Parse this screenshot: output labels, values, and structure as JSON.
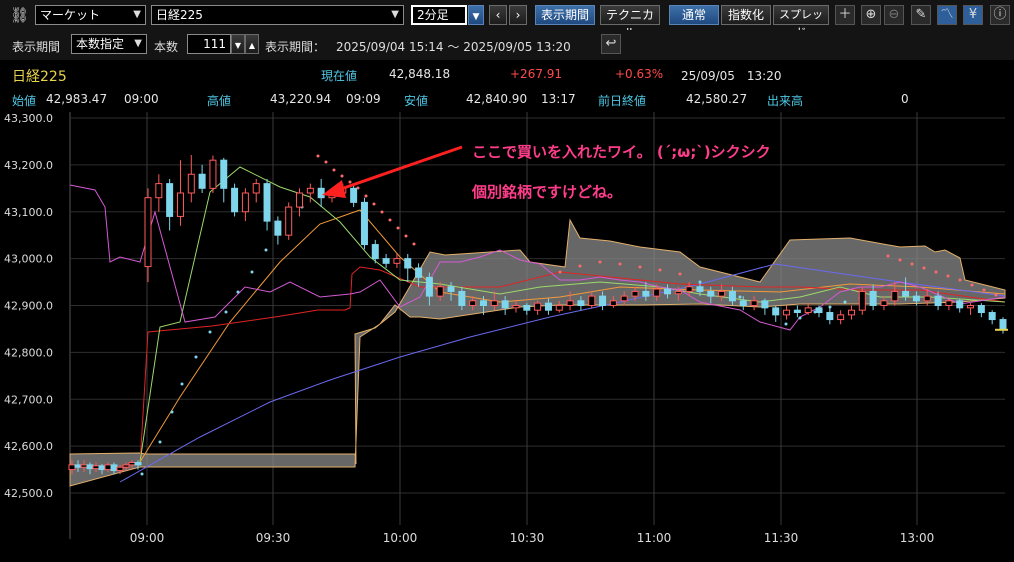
{
  "toolbar": {
    "market_select": "マーケット",
    "symbol_select": "日経225",
    "interval_select": "2分足",
    "period_button": "表示期間",
    "technical_button": "テクニカル",
    "normal_button": "通常",
    "index_button": "指数化",
    "spread_button": "スプレッド",
    "yen_icon": "¥"
  },
  "settings": {
    "period_label": "表示期間",
    "period_select": "本数指定",
    "count_label": "本数",
    "count_value": "111",
    "range_label": "表示期間：",
    "range_value": "2025/09/04 15:14 ～ 2025/09/05 13:20"
  },
  "quote": {
    "name": "日経225",
    "current_label": "現在値",
    "current_value": "42,848.18",
    "change": "+267.91",
    "change_pct": "+0.63%",
    "datetime": "25/09/05　13:20",
    "open_label": "始値",
    "open_value": "42,983.47",
    "open_time": "09:00",
    "high_label": "高値",
    "high_value": "43,220.94",
    "high_time": "09:09",
    "low_label": "安値",
    "low_value": "42,840.90",
    "low_time": "13:17",
    "prev_label": "前日終値",
    "prev_value": "42,580.27",
    "volume_label": "出来高",
    "volume_value": "0"
  },
  "annotation": {
    "line1": "ここで買いを入れたワイ。 (´;ω;`)シクシク",
    "line2": "個別銘柄ですけどね。"
  },
  "colors": {
    "up_candle": "#ff5a5a",
    "down_candle": "#7fd6ec",
    "cloud": "#8a8a8a",
    "annotation": "#ff3d8b"
  },
  "chart_data": {
    "type": "candlestick",
    "y_ticks": [
      "43,300.0",
      "43,200.0",
      "43,100.0",
      "43,000.0",
      "42,900.0",
      "42,800.0",
      "42,700.0",
      "42,600.0",
      "42,500.0"
    ],
    "x_ticks": [
      "09:00",
      "09:30",
      "10:00",
      "10:30",
      "11:00",
      "11:30",
      "13:00"
    ],
    "ylim": [
      42480,
      43300
    ],
    "candles": [
      [
        42550,
        42560,
        42540,
        42570
      ],
      [
        42560,
        42555,
        42545,
        42570
      ],
      [
        42555,
        42560,
        42545,
        42570
      ],
      [
        42560,
        42552,
        42540,
        42565
      ],
      [
        42552,
        42558,
        42545,
        42565
      ],
      [
        42558,
        42550,
        42540,
        42562
      ],
      [
        42550,
        42560,
        42545,
        42565
      ],
      [
        42560,
        42548,
        42540,
        42565
      ],
      [
        42548,
        42555,
        42540,
        42560
      ],
      [
        42555,
        42560,
        42548,
        42565
      ],
      [
        42560,
        42565,
        42552,
        42570
      ],
      [
        42565,
        42560,
        42550,
        42570
      ],
      [
        42983,
        43130,
        42950,
        43150
      ],
      [
        43130,
        43160,
        43100,
        43180
      ],
      [
        43160,
        43090,
        43060,
        43170
      ],
      [
        43090,
        43140,
        43070,
        43210
      ],
      [
        43140,
        43180,
        43120,
        43221
      ],
      [
        43180,
        43150,
        43140,
        43200
      ],
      [
        43150,
        43210,
        43140,
        43220
      ],
      [
        43210,
        43150,
        43120,
        43215
      ],
      [
        43150,
        43100,
        43090,
        43160
      ],
      [
        43100,
        43140,
        43080,
        43150
      ],
      [
        43140,
        43160,
        43120,
        43170
      ],
      [
        43160,
        43080,
        43060,
        43170
      ],
      [
        43080,
        43050,
        43030,
        43090
      ],
      [
        43050,
        43110,
        43040,
        43120
      ],
      [
        43110,
        43140,
        43090,
        43150
      ],
      [
        43140,
        43150,
        43120,
        43160
      ],
      [
        43150,
        43130,
        43110,
        43170
      ],
      [
        43130,
        43140,
        43120,
        43150
      ],
      [
        43140,
        43150,
        43130,
        43160
      ],
      [
        43150,
        43120,
        43110,
        43160
      ],
      [
        43120,
        43030,
        43020,
        43130
      ],
      [
        43030,
        43000,
        42990,
        43040
      ],
      [
        43000,
        42990,
        42980,
        43010
      ],
      [
        42990,
        43000,
        42980,
        43010
      ],
      [
        43000,
        42980,
        42950,
        43010
      ],
      [
        42980,
        42960,
        42940,
        42990
      ],
      [
        42960,
        42920,
        42900,
        42970
      ],
      [
        42920,
        42940,
        42910,
        42950
      ],
      [
        42940,
        42930,
        42910,
        42950
      ],
      [
        42930,
        42900,
        42890,
        42940
      ],
      [
        42900,
        42910,
        42890,
        42920
      ],
      [
        42910,
        42900,
        42880,
        42920
      ],
      [
        42900,
        42910,
        42890,
        42930
      ],
      [
        42910,
        42895,
        42880,
        42920
      ],
      [
        42895,
        42900,
        42885,
        42910
      ],
      [
        42900,
        42890,
        42880,
        42905
      ],
      [
        42890,
        42905,
        42880,
        42910
      ],
      [
        42905,
        42890,
        42880,
        42915
      ],
      [
        42890,
        42900,
        42885,
        42910
      ],
      [
        42900,
        42910,
        42890,
        42930
      ],
      [
        42910,
        42900,
        42890,
        42920
      ],
      [
        42900,
        42920,
        42895,
        42930
      ],
      [
        42920,
        42900,
        42890,
        42930
      ],
      [
        42900,
        42910,
        42895,
        42920
      ],
      [
        42910,
        42920,
        42900,
        42930
      ],
      [
        42920,
        42930,
        42910,
        42940
      ],
      [
        42930,
        42920,
        42910,
        42950
      ],
      [
        42920,
        42935,
        42910,
        42945
      ],
      [
        42935,
        42925,
        42915,
        42945
      ],
      [
        42925,
        42930,
        42910,
        42940
      ],
      [
        42930,
        42940,
        42920,
        42950
      ],
      [
        42940,
        42930,
        42920,
        42950
      ],
      [
        42930,
        42920,
        42905,
        42940
      ],
      [
        42920,
        42930,
        42910,
        42945
      ],
      [
        42930,
        42910,
        42900,
        42940
      ],
      [
        42910,
        42900,
        42890,
        42920
      ],
      [
        42900,
        42910,
        42890,
        42920
      ],
      [
        42910,
        42895,
        42880,
        42915
      ],
      [
        42895,
        42880,
        42865,
        42900
      ],
      [
        42880,
        42890,
        42870,
        42900
      ],
      [
        42890,
        42885,
        42875,
        42900
      ],
      [
        42885,
        42895,
        42880,
        42905
      ],
      [
        42895,
        42885,
        42875,
        42900
      ],
      [
        42885,
        42870,
        42860,
        42895
      ],
      [
        42870,
        42880,
        42860,
        42890
      ],
      [
        42880,
        42890,
        42870,
        42900
      ],
      [
        42890,
        42930,
        42880,
        42940
      ],
      [
        42930,
        42900,
        42890,
        42945
      ],
      [
        42900,
        42910,
        42890,
        42920
      ],
      [
        42910,
        42930,
        42900,
        42950
      ],
      [
        42930,
        42920,
        42910,
        42960
      ],
      [
        42920,
        42910,
        42900,
        42930
      ],
      [
        42910,
        42920,
        42900,
        42935
      ],
      [
        42920,
        42900,
        42890,
        42930
      ],
      [
        42900,
        42910,
        42890,
        42915
      ],
      [
        42910,
        42895,
        42885,
        42915
      ],
      [
        42895,
        42900,
        42880,
        42905
      ],
      [
        42900,
        42885,
        42875,
        42905
      ],
      [
        42885,
        42870,
        42860,
        42890
      ],
      [
        42870,
        42848,
        42840,
        42875
      ]
    ]
  }
}
